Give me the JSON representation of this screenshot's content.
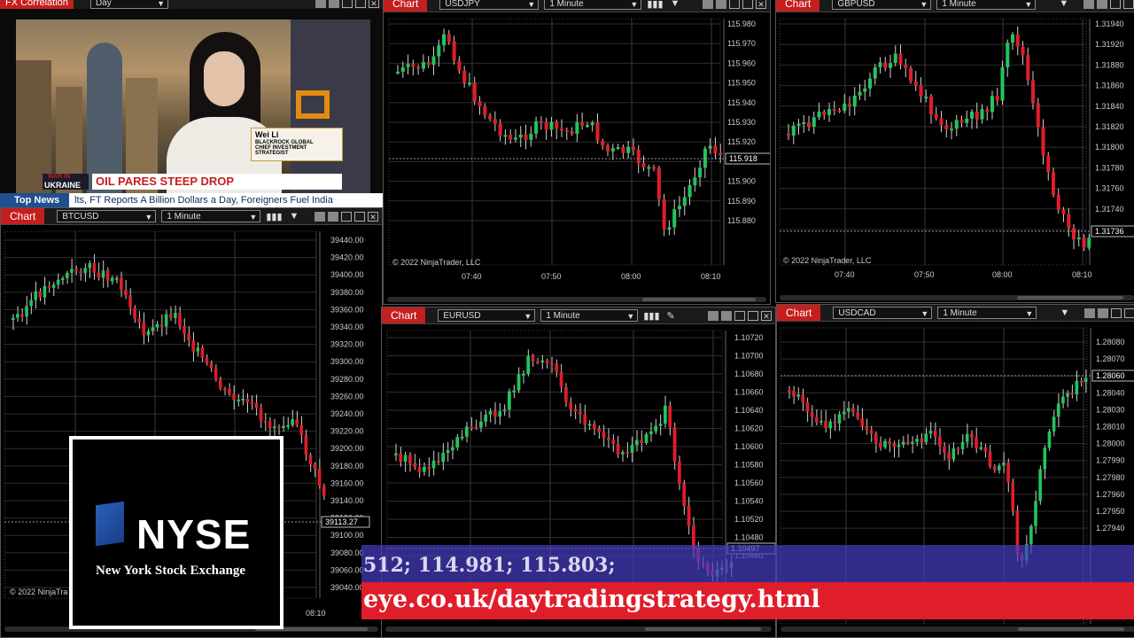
{
  "window_title": "FX Correlation",
  "top_left_interval": "Day",
  "video": {
    "name": "Wei Li",
    "title": "BLACKROCK GLOBAL CHIEF INVESTMENT STRATEGIST",
    "war_line1": "WAR IN",
    "war_line2": "UKRAINE",
    "headline": "OIL PARES STEEP DROP",
    "ticker_label": "Top News",
    "ticker_text": "lts, FT Reports     A Billion Dollars a Day, Foreigners Fuel India"
  },
  "nyse": {
    "name": "NYSE",
    "subtitle": "New York Stock Exchange"
  },
  "overlay": {
    "numbers": "512; 114.981; 115.803;",
    "url": "eye.co.uk/daytradingstrategy.html"
  },
  "charts": {
    "usdjpy": {
      "tab": "Chart",
      "instrument": "USDJPY",
      "interval": "1 Minute",
      "price_labels": [
        "115.980",
        "115.970",
        "115.960",
        "115.950",
        "115.940",
        "115.930",
        "115.920",
        "115.910",
        "115.900",
        "115.890",
        "115.880"
      ],
      "last_price": "115.918",
      "time_labels": [
        "07:40",
        "07:50",
        "08:00",
        "08:10"
      ],
      "copyright": "© 2022 NinjaTrader, LLC",
      "colors": {
        "up": "#22c55e",
        "down": "#e11d2a"
      }
    },
    "gbpusd": {
      "tab": "Chart",
      "instrument": "GBPUSD",
      "interval": "1 Minute",
      "price_labels": [
        "1.31940",
        "1.31920",
        "1.31880",
        "1.31860",
        "1.31840",
        "1.31820",
        "1.31800",
        "1.31780",
        "1.31760",
        "1.31740",
        "1.31720"
      ],
      "last_price": "1.31736",
      "time_labels": [
        "07:40",
        "07:50",
        "08:00",
        "08:10"
      ],
      "copyright": "© 2022 NinjaTrader, LLC"
    },
    "btcusd": {
      "tab": "Chart",
      "instrument": "BTCUSD",
      "interval": "1 Minute",
      "price_labels": [
        "39440.00",
        "39420.00",
        "39400.00",
        "39380.00",
        "39360.00",
        "39340.00",
        "39320.00",
        "39300.00",
        "39280.00",
        "39260.00",
        "39240.00",
        "39220.00",
        "39200.00",
        "39180.00",
        "39160.00",
        "39140.00",
        "39120.00",
        "39100.00",
        "39080.00",
        "39060.00",
        "39040.00"
      ],
      "last_price": "39113.27",
      "time_labels": [
        "08:10"
      ],
      "copyright": "© 2022 NinjaTra"
    },
    "eurusd": {
      "tab": "Chart",
      "instrument": "EURUSD",
      "interval": "1 Minute",
      "price_labels": [
        "1.10720",
        "1.10700",
        "1.10680",
        "1.10660",
        "1.10640",
        "1.10620",
        "1.10600",
        "1.10580",
        "1.10560",
        "1.10540",
        "1.10520",
        "1.10480",
        "1.10460"
      ],
      "last_price": "1.10497"
    },
    "usdcad": {
      "tab": "Chart",
      "instrument": "USDCAD",
      "interval": "1 Minute",
      "price_labels": [
        "1.28080",
        "1.28070",
        "1.28050",
        "1.28040",
        "1.28030",
        "1.28010",
        "1.28000",
        "1.27990",
        "1.27980",
        "1.27960",
        "1.27950",
        "1.27940"
      ],
      "last_price": "1.28060"
    }
  }
}
